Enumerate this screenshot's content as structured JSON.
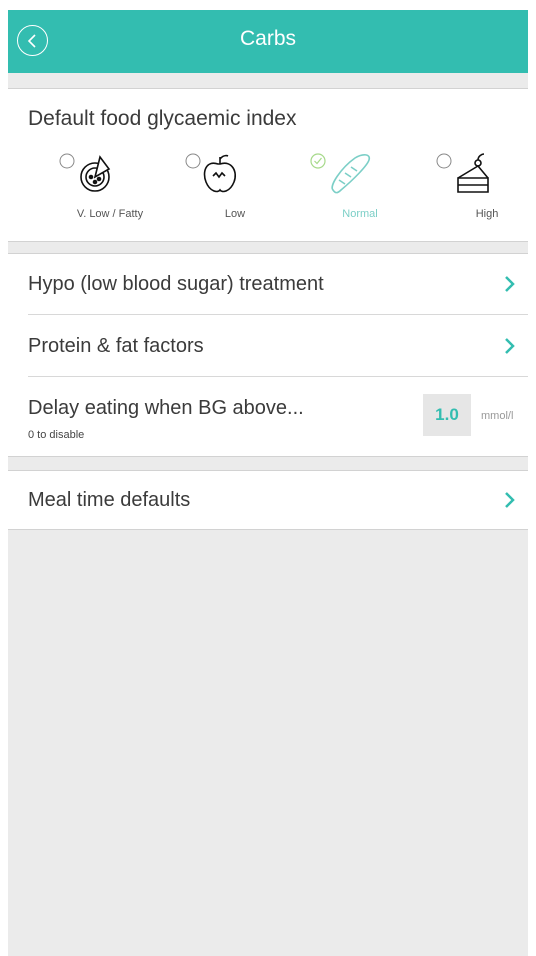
{
  "header": {
    "title": "Carbs",
    "back_icon": "chevron-left-icon"
  },
  "gi": {
    "title": "Default food glycaemic index",
    "selected": "Normal",
    "options": [
      {
        "label": "V. Low / Fatty",
        "icon": "pizza-icon",
        "selected": false
      },
      {
        "label": "Low",
        "icon": "apple-icon",
        "selected": false
      },
      {
        "label": "Normal",
        "icon": "bread-icon",
        "selected": true
      },
      {
        "label": "High",
        "icon": "cake-icon",
        "selected": false
      }
    ]
  },
  "menu": {
    "hypo": "Hypo (low blood sugar) treatment",
    "protein": "Protein & fat factors",
    "delay": {
      "label": "Delay eating when BG above...",
      "sub": "0 to disable",
      "value": "1.0",
      "unit": "mmol/l"
    },
    "meal": "Meal time defaults"
  },
  "colors": {
    "accent": "#33bdb0",
    "selected_green": "#a6d98a",
    "background": "#ebebeb"
  }
}
